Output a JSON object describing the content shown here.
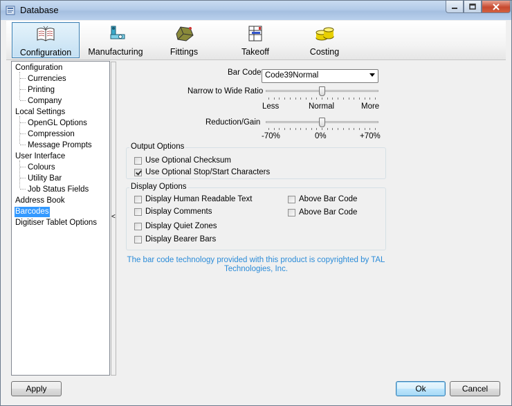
{
  "window": {
    "title": "Database"
  },
  "toolbar": {
    "items": [
      {
        "label": "Configuration",
        "icon": "book-icon",
        "active": true
      },
      {
        "label": "Manufacturing",
        "icon": "machine-icon",
        "active": false
      },
      {
        "label": "Fittings",
        "icon": "fitting-icon",
        "active": false
      },
      {
        "label": "Takeoff",
        "icon": "takeoff-icon",
        "active": false
      },
      {
        "label": "Costing",
        "icon": "coins-icon",
        "active": false
      }
    ]
  },
  "tree": {
    "items": [
      {
        "label": "Configuration",
        "level": 0
      },
      {
        "label": "Currencies",
        "level": 1
      },
      {
        "label": "Printing",
        "level": 1
      },
      {
        "label": "Company",
        "level": 1
      },
      {
        "label": "Local Settings",
        "level": 0
      },
      {
        "label": "OpenGL Options",
        "level": 1
      },
      {
        "label": "Compression",
        "level": 1
      },
      {
        "label": "Message Prompts",
        "level": 1
      },
      {
        "label": "User Interface",
        "level": 0
      },
      {
        "label": "Colours",
        "level": 1
      },
      {
        "label": "Utility Bar",
        "level": 1
      },
      {
        "label": "Job Status Fields",
        "level": 1
      },
      {
        "label": "Address Book",
        "level": 0
      },
      {
        "label": "Barcodes",
        "level": 0,
        "selected": true
      },
      {
        "label": "Digitiser Tablet Options",
        "level": 0
      }
    ]
  },
  "splitter": {
    "glyph": "<"
  },
  "barcode": {
    "bar_code_label": "Bar Code",
    "bar_code_value": "Code39Normal",
    "ratio_label": "Narrow to Wide Ratio",
    "ratio_min": "Less",
    "ratio_mid": "Normal",
    "ratio_max": "More",
    "ratio_value": 0.5,
    "reduction_label": "Reduction/Gain",
    "reduction_min": "-70%",
    "reduction_mid": "0%",
    "reduction_max": "+70%",
    "reduction_value": 0.5
  },
  "output_options": {
    "title": "Output Options",
    "checksum_label": "Use Optional Checksum",
    "checksum_checked": false,
    "stopstart_label": "Use Optional Stop/Start Characters",
    "stopstart_checked": true
  },
  "display_options": {
    "title": "Display Options",
    "human_readable_label": "Display Human Readable Text",
    "comments_label": "Display Comments",
    "quiet_zones_label": "Display Quiet Zones",
    "bearer_bars_label": "Display Bearer Bars",
    "above_1_label": "Above Bar Code",
    "above_2_label": "Above Bar Code"
  },
  "copyright": "The bar code technology provided with this product is copyrighted by TAL Technologies, Inc.",
  "buttons": {
    "apply": "Apply",
    "ok": "Ok",
    "cancel": "Cancel"
  },
  "colors": {
    "accent": "#3399ff",
    "link_text": "#2a8bd8"
  }
}
